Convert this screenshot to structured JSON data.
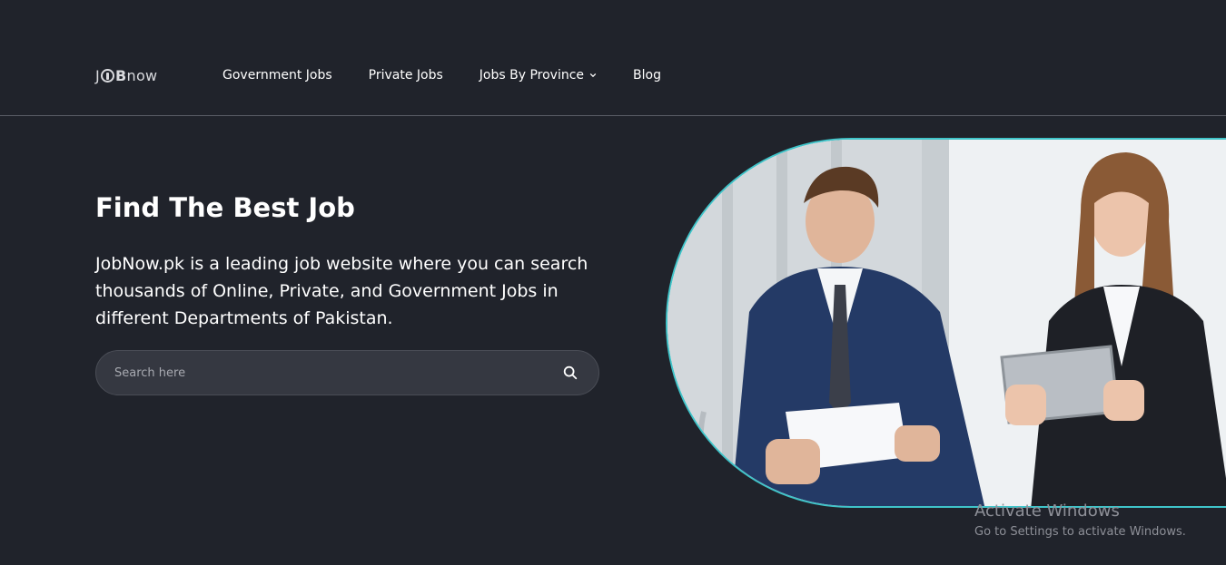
{
  "header": {
    "logo": {
      "part1": "J",
      "part2": "B",
      "part3": "now"
    },
    "nav": [
      {
        "label": "Government Jobs"
      },
      {
        "label": "Private Jobs"
      },
      {
        "label": "Jobs By Province",
        "has_dropdown": true
      },
      {
        "label": "Blog"
      }
    ]
  },
  "hero": {
    "title": "Find The Best Job",
    "description": "JobNow.pk is a leading job website where you can search thousands of Online, Private, and Government Jobs in different Departments of Pakistan.",
    "search": {
      "placeholder": "Search here",
      "value": "",
      "icon": "search-icon"
    },
    "image": {
      "accent_color": "#3fc4c9"
    }
  },
  "watermark": {
    "title": "Activate Windows",
    "subtitle": "Go to Settings to activate Windows."
  },
  "colors": {
    "background": "#20232b",
    "search_bg": "#353841",
    "accent": "#3fc4c9"
  }
}
